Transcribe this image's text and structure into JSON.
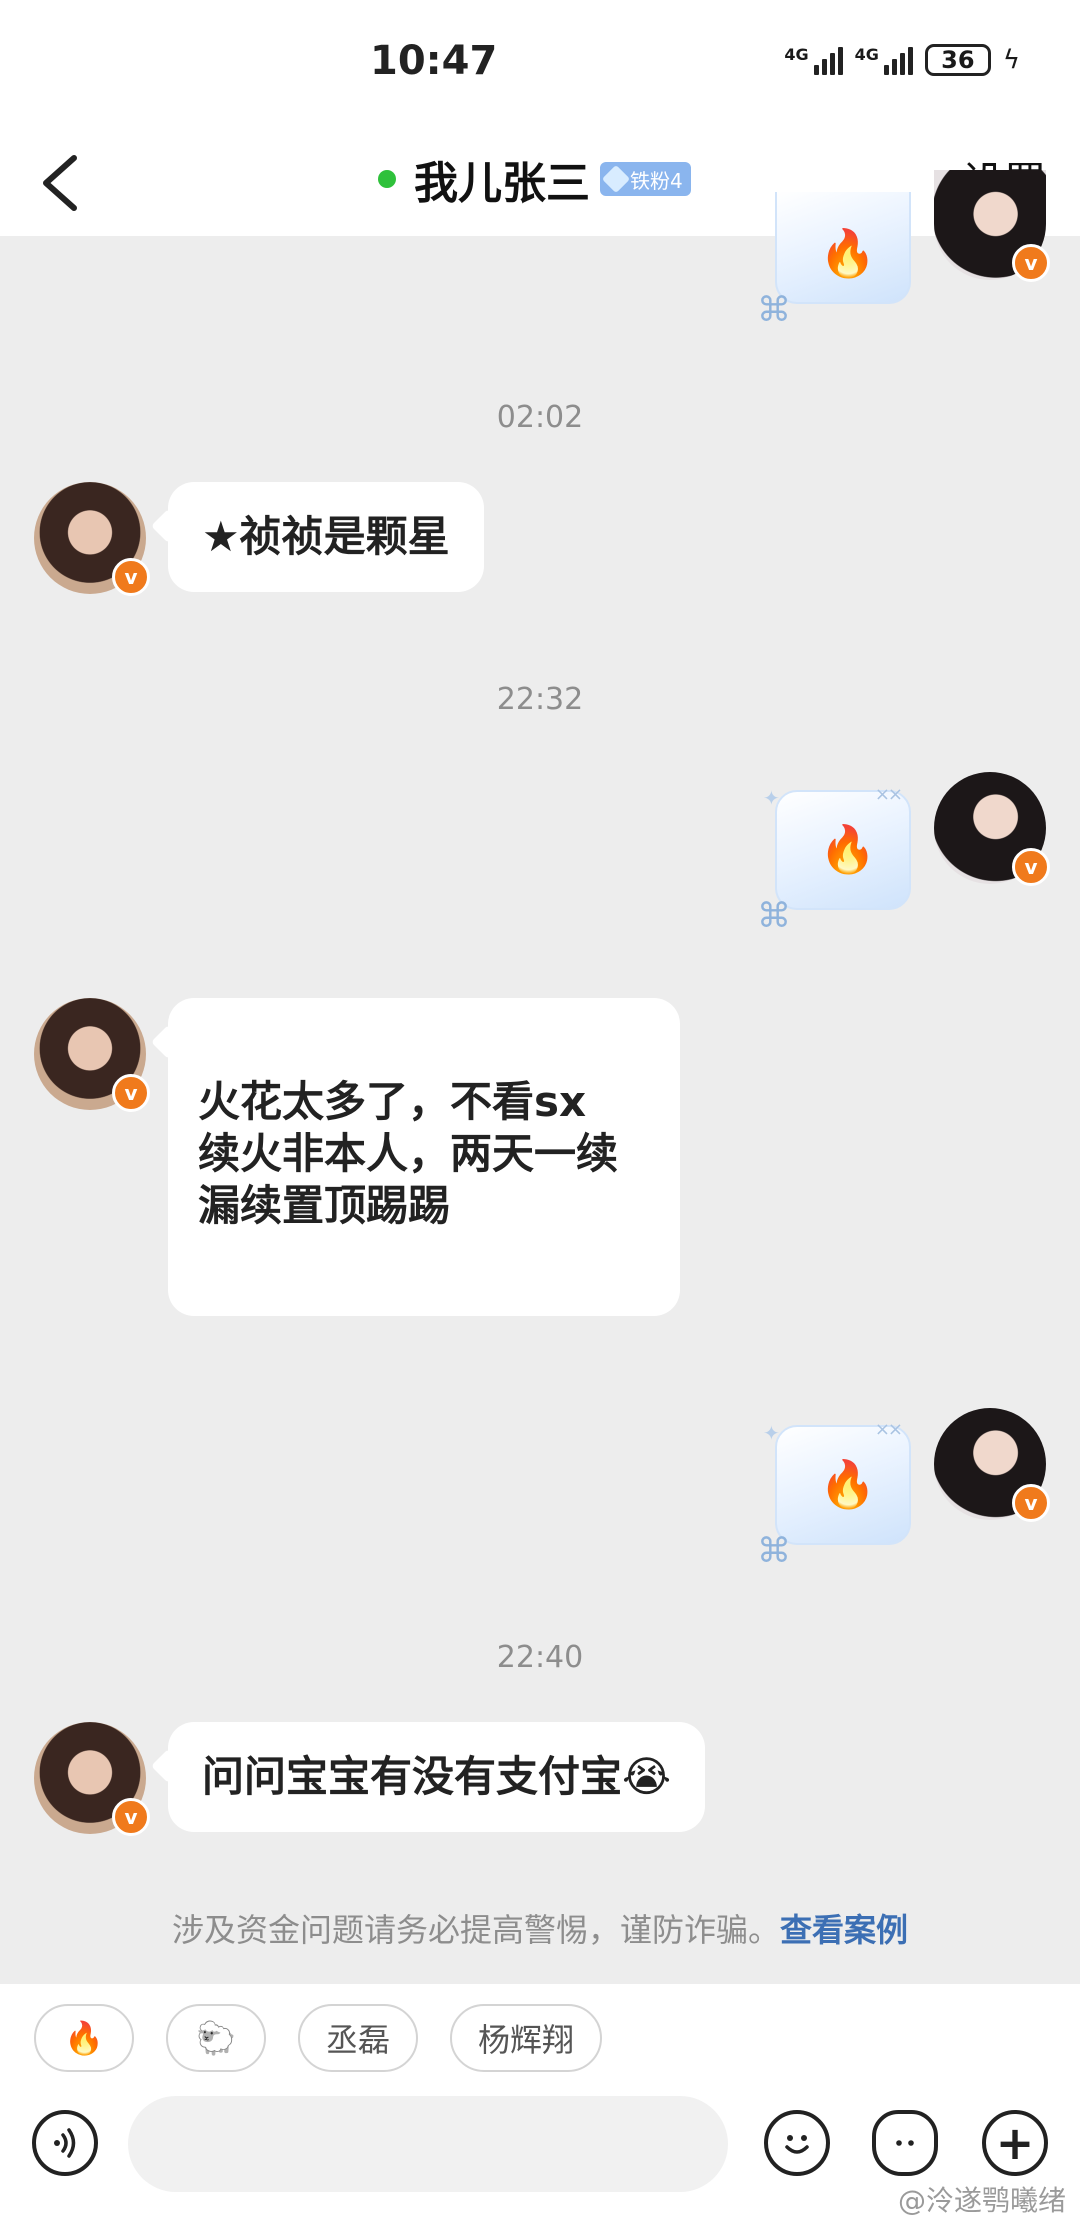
{
  "status_bar": {
    "time": "10:47",
    "network_1": "4G",
    "network_2": "4G",
    "battery": "36"
  },
  "header": {
    "title": "我儿张三",
    "fan_badge": "铁粉4",
    "settings_label": "设置",
    "online_color": "#2fc13b"
  },
  "messages": {
    "ts_1": "02:02",
    "msg_1": "★祯祯是颗星",
    "ts_2": "22:32",
    "msg_2": "火花太多了，不看sx\n续火非本人，两天一续\n漏续置顶踢踢",
    "ts_3": "22:40",
    "msg_3": "问问宝宝有没有支付宝😭",
    "spark_emoji": "🔥",
    "verified_mark": "v"
  },
  "warning": {
    "text": "涉及资金问题请务必提高警惕，谨防诈骗。",
    "link": "查看案例"
  },
  "quick_replies": [
    "🔥",
    "🐑",
    "丞磊",
    "杨辉翔"
  ],
  "input": {
    "value": "",
    "plus": "+"
  },
  "watermark": "@泠遂鹗曦绪",
  "colors": {
    "background": "#ededed",
    "verified_badge": "#f07a1c",
    "link": "#3c6fb4"
  }
}
